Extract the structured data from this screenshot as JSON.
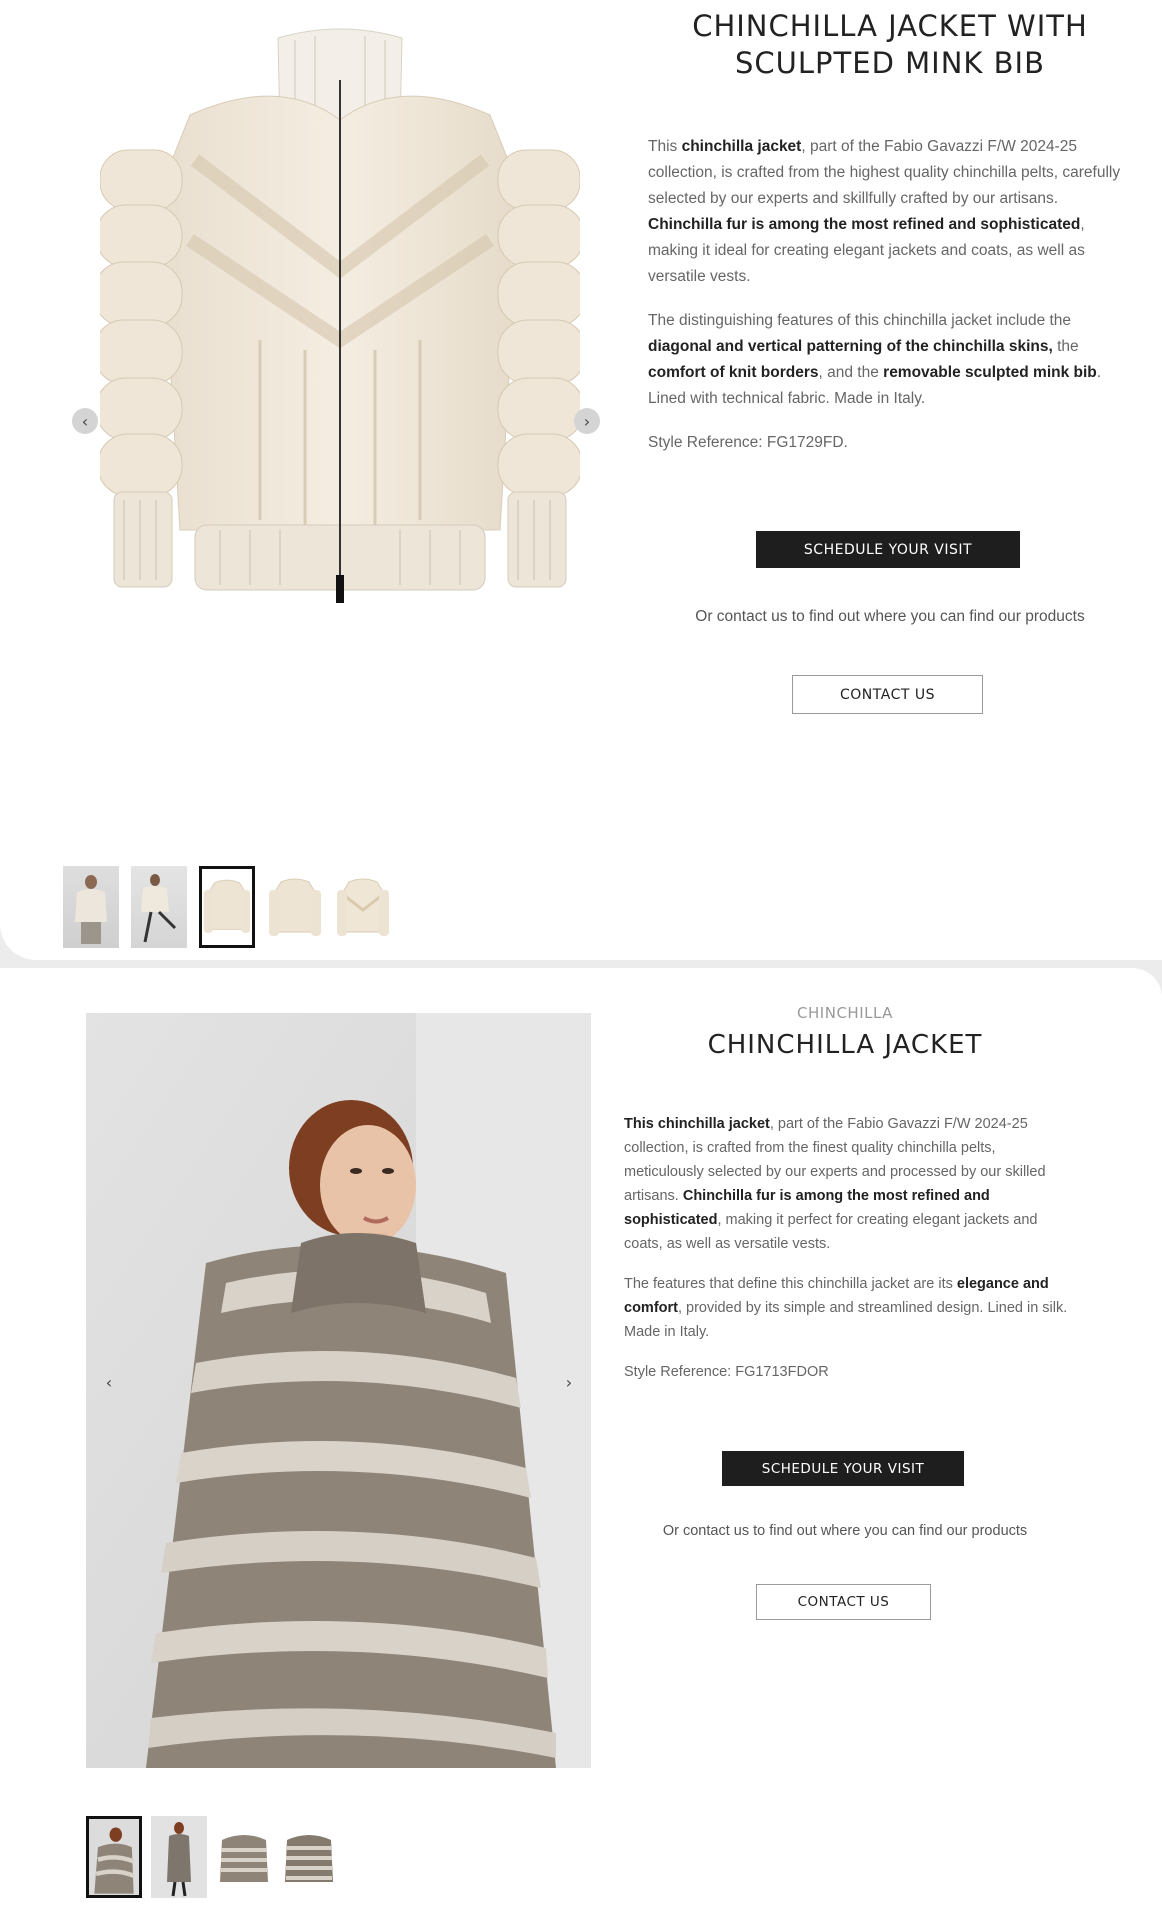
{
  "product1": {
    "title_line1": "CHINCHILLA JACKET WITH",
    "title_line2": "SCULPTED MINK BIB",
    "desc_p1": [
      {
        "t": "This ",
        "b": false
      },
      {
        "t": "chinchilla jacket",
        "b": true
      },
      {
        "t": ", part of the Fabio Gavazzi F/W 2024-25 collection, is crafted from the highest quality chinchilla pelts, carefully selected by our experts and skillfully crafted by our artisans. ",
        "b": false
      },
      {
        "t": "Chinchilla fur is among the most refined and sophisticated",
        "b": true
      },
      {
        "t": ", making it ideal for creating elegant jackets and coats, as well as versatile vests.",
        "b": false
      }
    ],
    "desc_p2": [
      {
        "t": "The distinguishing features of this chinchilla jacket include the ",
        "b": false
      },
      {
        "t": "diagonal and vertical patterning of the chinchilla skins,",
        "b": true
      },
      {
        "t": " the ",
        "b": false
      },
      {
        "t": "comfort of knit borders",
        "b": true
      },
      {
        "t": ", and the ",
        "b": false
      },
      {
        "t": "removable sculpted mink bib",
        "b": true
      },
      {
        "t": ". Lined with technical fabric. Made in Italy.",
        "b": false
      }
    ],
    "style_ref": "Style Reference: FG1729FD.",
    "schedule_label": "SCHEDULE YOUR VISIT",
    "contact_text": "Or contact us to find out where you can find our products",
    "contact_label": "CONTACT US",
    "prev_arrow": "‹",
    "next_arrow": "›"
  },
  "product2": {
    "category": "CHINCHILLA",
    "title": "CHINCHILLA JACKET",
    "desc_p1": [
      {
        "t": "This chinchilla jacket",
        "b": true
      },
      {
        "t": ", part of the Fabio Gavazzi F/W 2024-25 collection, is crafted from the finest quality chinchilla pelts, meticulously selected by our experts and processed by our skilled artisans. ",
        "b": false
      },
      {
        "t": "Chinchilla fur is among the most refined and sophisticated",
        "b": true
      },
      {
        "t": ", making it perfect for creating elegant jackets and coats, as well as versatile vests.",
        "b": false
      }
    ],
    "desc_p2": [
      {
        "t": "The features that define this chinchilla jacket are its ",
        "b": false
      },
      {
        "t": "elegance and comfort",
        "b": true
      },
      {
        "t": ", provided by its simple and streamlined design. Lined in silk. Made in Italy.",
        "b": false
      }
    ],
    "style_ref": "Style Reference: FG1713FDOR",
    "schedule_label": "SCHEDULE YOUR VISIT",
    "contact_text": "Or contact us to find out where you can find our products",
    "contact_label": "CONTACT US",
    "prev_arrow": "‹",
    "next_arrow": "›"
  },
  "colors": {
    "accent_dark": "#1e1e1e",
    "cream_fur": "#ede3d3",
    "grey_fur": "#8f8478"
  }
}
